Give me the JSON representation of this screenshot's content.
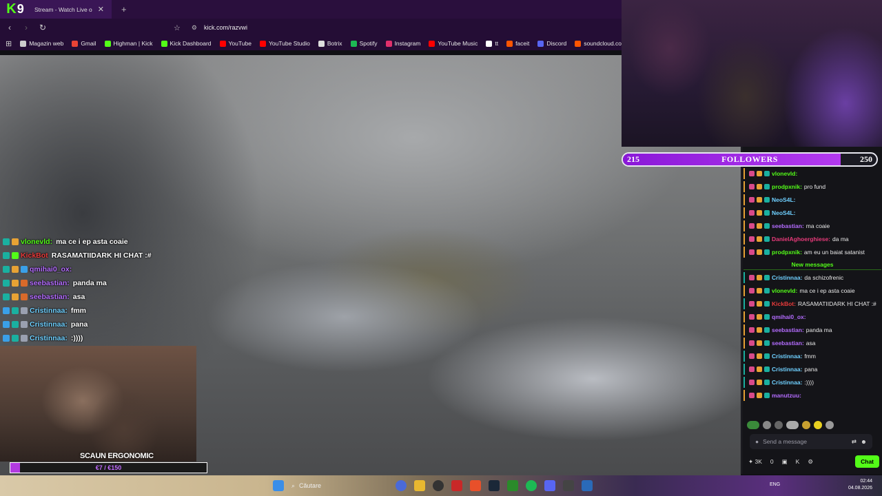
{
  "browser": {
    "logo_letter": "9",
    "tab_title": "Stream - Watch Live o",
    "tab_close": "✕",
    "tab_new": "+",
    "url": "kick.com/razvwi",
    "bookmarks": [
      {
        "label": "Magazin web",
        "color": "#cccccc"
      },
      {
        "label": "Gmail",
        "color": "#ea4335"
      },
      {
        "label": "Highman | Kick",
        "color": "#53fc18"
      },
      {
        "label": "Kick Dashboard",
        "color": "#53fc18"
      },
      {
        "label": "YouTube",
        "color": "#ff0000"
      },
      {
        "label": "YouTube Studio",
        "color": "#ff0000"
      },
      {
        "label": "Botrix",
        "color": "#dddddd"
      },
      {
        "label": "Spotify",
        "color": "#1db954"
      },
      {
        "label": "Instagram",
        "color": "#e1306c"
      },
      {
        "label": "YouTube Music",
        "color": "#ff0000"
      },
      {
        "label": "tt",
        "color": "#ffffff"
      },
      {
        "label": "faceit",
        "color": "#ff5500"
      },
      {
        "label": "Discord",
        "color": "#5865f2"
      },
      {
        "label": "soundcloud.com/",
        "color": "#ff5500"
      }
    ]
  },
  "followers": {
    "current": "215",
    "label": "FOLLOWERS",
    "goal": "250",
    "progress": 0.86
  },
  "overlay_chat": [
    {
      "user": "vlonevld:",
      "user_color": "#53fc18",
      "msg": "ma ce i ep asta coaie",
      "badges": [
        "#1ab0a0",
        "#e8a234"
      ]
    },
    {
      "user": "KickBot",
      "user_color": "#e83a3a",
      "msg": "RASAMATIIDARK HI CHAT :#",
      "badges": [
        "#1ab0a0",
        "#53fc18"
      ]
    },
    {
      "user": "qmihai0_ox:",
      "user_color": "#b46cff",
      "msg": "",
      "badges": [
        "#1ab0a0",
        "#e8a234",
        "#3aa0e8"
      ]
    },
    {
      "user": "seebastian:",
      "user_color": "#b46cff",
      "msg": "panda ma",
      "badges": [
        "#1ab0a0",
        "#e8a234",
        "#d86a2a"
      ]
    },
    {
      "user": "seebastian:",
      "user_color": "#b46cff",
      "msg": "asa",
      "badges": [
        "#1ab0a0",
        "#e8a234",
        "#d86a2a"
      ]
    },
    {
      "user": "Cristinnaa:",
      "user_color": "#6fd0ff",
      "msg": "fmm",
      "badges": [
        "#3aa0e8",
        "#1ab0a0",
        "#9aa0b0"
      ]
    },
    {
      "user": "Cristinnaa:",
      "user_color": "#6fd0ff",
      "msg": "pana",
      "badges": [
        "#3aa0e8",
        "#1ab0a0",
        "#9aa0b0"
      ]
    },
    {
      "user": "Cristinnaa:",
      "user_color": "#6fd0ff",
      "msg": ":))))",
      "badges": [
        "#3aa0e8",
        "#1ab0a0",
        "#9aa0b0"
      ]
    }
  ],
  "webcam_small": {
    "title": "SCAUN ERGONOMIC",
    "goal_text": "€7 / €150",
    "progress": 0.05
  },
  "chat": {
    "messages": [
      {
        "user": "vlonevld:",
        "user_color": "#53fc18",
        "msg": "",
        "border": "#e8a234"
      },
      {
        "user": "prodpxnik:",
        "user_color": "#53fc18",
        "msg": "pro fund",
        "border": "#e8a234"
      },
      {
        "user": "NeoS4L:",
        "user_color": "#6fd0ff",
        "msg": "",
        "border": "#e8a234"
      },
      {
        "user": "NeoS4L:",
        "user_color": "#6fd0ff",
        "msg": "",
        "border": "#e8a234"
      },
      {
        "user": "seebastian:",
        "user_color": "#b46cff",
        "msg": "ma coaie",
        "border": "#e8a234"
      },
      {
        "user": "DanielAghoerghiese:",
        "user_color": "#e83a7a",
        "msg": "da ma",
        "border": "#e8a234"
      },
      {
        "user": "prodpxnik:",
        "user_color": "#53fc18",
        "msg": "am eu un baiat satanist",
        "border": "#e8a234"
      }
    ],
    "new_messages_label": "New messages",
    "new_messages": [
      {
        "user": "Cristinnaa:",
        "user_color": "#6fd0ff",
        "msg": "da schizofrenic",
        "border": "#1ab0a0"
      },
      {
        "user": "vlonevld:",
        "user_color": "#53fc18",
        "msg": "ma ce i ep asta coaie",
        "border": "#e8a234"
      },
      {
        "user": "KickBot:",
        "user_color": "#e83a3a",
        "msg": "RASAMATIIDARK HI CHAT :#",
        "border": "#1ab0a0"
      },
      {
        "user": "qmihai0_ox:",
        "user_color": "#b46cff",
        "msg": "",
        "border": "#e8a234"
      },
      {
        "user": "seebastian:",
        "user_color": "#b46cff",
        "msg": "panda ma",
        "border": "#e8a234"
      },
      {
        "user": "seebastian:",
        "user_color": "#b46cff",
        "msg": "asa",
        "border": "#e8a234"
      },
      {
        "user": "Cristinnaa:",
        "user_color": "#6fd0ff",
        "msg": "fmm",
        "border": "#1ab0a0"
      },
      {
        "user": "Cristinnaa:",
        "user_color": "#6fd0ff",
        "msg": "pana",
        "border": "#1ab0a0"
      },
      {
        "user": "Cristinnaa:",
        "user_color": "#6fd0ff",
        "msg": ":))))",
        "border": "#1ab0a0"
      },
      {
        "user": "manutzuu:",
        "user_color": "#b46cff",
        "msg": "",
        "border": "#e8a234"
      }
    ],
    "input_placeholder": "Send a message",
    "viewers": "3K",
    "count": "0",
    "key_label": "K",
    "chat_button": "Chat"
  },
  "taskbar": {
    "search_label": "Căutare",
    "lang": "ENG",
    "time": "02:44",
    "date": "04.08.2026"
  }
}
